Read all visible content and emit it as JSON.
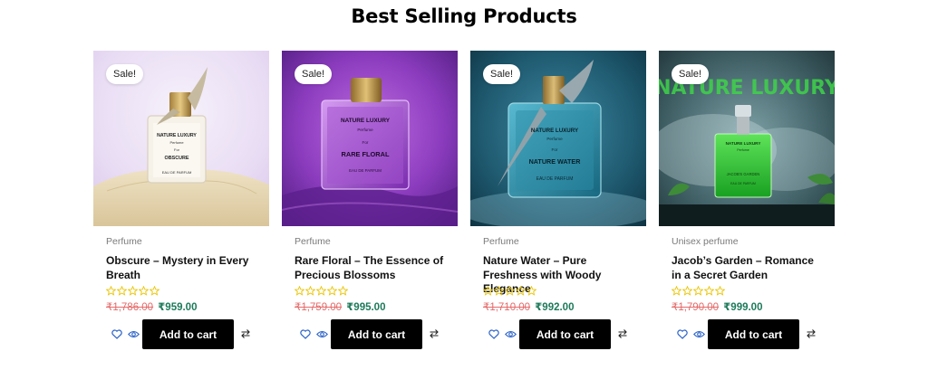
{
  "section": {
    "title": "Best Selling Products"
  },
  "products": [
    {
      "sale_badge": "Sale!",
      "category": "Perfume",
      "title": "Obscure – Mystery in Every Breath",
      "old_price": "₹1,786.00",
      "new_price": "₹959.00",
      "rating": 0,
      "add_to_cart": "Add to cart",
      "bottle": {
        "brand": "NATURE LUXURY",
        "line1": "Perfume",
        "line2": "For",
        "name": "OBSCURE",
        "footer": "EAU DE PARFUM"
      }
    },
    {
      "sale_badge": "Sale!",
      "category": "Perfume",
      "title": "Rare Floral – The Essence of Precious Blossoms",
      "old_price": "₹1,759.00",
      "new_price": "₹995.00",
      "rating": 0,
      "add_to_cart": "Add to cart",
      "bottle": {
        "brand": "NATURE LUXURY",
        "line1": "Perfume",
        "line2": "For",
        "name": "RARE FLORAL",
        "footer": "EAU DE PARFUM"
      }
    },
    {
      "sale_badge": "Sale!",
      "category": "Perfume",
      "title": "Nature Water – Pure Freshness with Woody Elegance",
      "old_price": "₹1,710.00",
      "new_price": "₹992.00",
      "rating": 0,
      "add_to_cart": "Add to cart",
      "bottle": {
        "brand": "NATURE LUXURY",
        "line1": "Perfume",
        "line2": "For",
        "name": "NATURE WATER",
        "footer": "EAU DE PARFUM"
      }
    },
    {
      "sale_badge": "Sale!",
      "category": "Unisex perfume",
      "title": "Jacob’s Garden – Romance in a Secret Garden",
      "old_price": "₹1,790.00",
      "new_price": "₹999.00",
      "rating": 0,
      "add_to_cart": "Add to cart",
      "bottle": {
        "brand": "NATURE LUXURY",
        "line1": "Perfume",
        "line2": "",
        "name": "JACOB'S GARDEN",
        "footer": "EAU DE PARFUM"
      },
      "backdrop_text": "NATURE LUXURY"
    }
  ],
  "colors": {
    "star_outline": "#e9c400",
    "old_price": "#e46a6a",
    "new_price": "#1c7a5a",
    "action_icons": "#2a62c9",
    "button_bg": "#000000"
  },
  "icons": {
    "wishlist": "heart-icon",
    "quick_view": "eye-icon",
    "compare": "compare-arrows-icon",
    "rating": "star-outline-icon"
  }
}
